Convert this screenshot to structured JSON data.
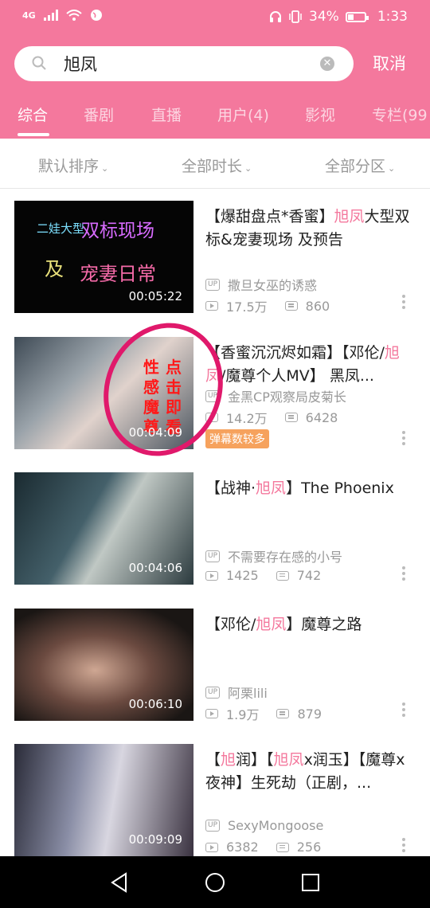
{
  "status": {
    "network": "4G",
    "battery": "34%",
    "battery_level": 0.34,
    "time": "1:33"
  },
  "search": {
    "query": "旭凤",
    "cancel": "取消"
  },
  "tabs": [
    "综合",
    "番剧",
    "直播",
    "用户(4)",
    "影视",
    "专栏(99"
  ],
  "filters": [
    "默认排序",
    "全部时长",
    "全部分区"
  ],
  "colors": {
    "accent": "#f4789d",
    "tag": "#f6a25d"
  },
  "videos": [
    {
      "title_parts": [
        "【爆甜盘点*香蜜】",
        "旭凤",
        "大型双标&宠妻现场 及预告"
      ],
      "duration": "00:05:22",
      "uploader": "撒旦女巫的诱惑",
      "views": "17.5万",
      "danmaku": "860",
      "thumb_text": {
        "t1": "二娃大型",
        "t2": "双标现场",
        "t3": "及",
        "t4": "宠妻日常"
      }
    },
    {
      "title_parts": [
        "【香蜜沉沉烬如霜】【邓伦/",
        "旭凤",
        "/魔尊个人MV】 黑凤..."
      ],
      "duration": "00:04:09",
      "uploader": "金黑CP观察局皮菊长",
      "views": "14.2万",
      "danmaku": "6428",
      "tag": "弹幕数较多",
      "thumb_text": {
        "c1": "点",
        "c2": "击",
        "c3": "即",
        "c4": "看",
        "c5": "性",
        "c6": "感",
        "c7": "魔",
        "c8": "尊"
      }
    },
    {
      "title_parts": [
        "【战神·",
        "旭凤",
        "】The Phoenix"
      ],
      "duration": "00:04:06",
      "uploader": "不需要存在感的小号",
      "views": "1425",
      "danmaku": "742"
    },
    {
      "title_parts": [
        "【邓伦/",
        "旭凤",
        "】魔尊之路"
      ],
      "duration": "00:06:10",
      "uploader": "阿栗lili",
      "views": "1.9万",
      "danmaku": "879"
    },
    {
      "title_parts": [
        "【",
        "旭",
        "润】【",
        "旭凤",
        "x润玉】【魔尊x夜神】生死劫（正剧，..."
      ],
      "duration": "00:09:09",
      "uploader": "SexyMongoose",
      "views": "6382",
      "danmaku": "256"
    }
  ]
}
